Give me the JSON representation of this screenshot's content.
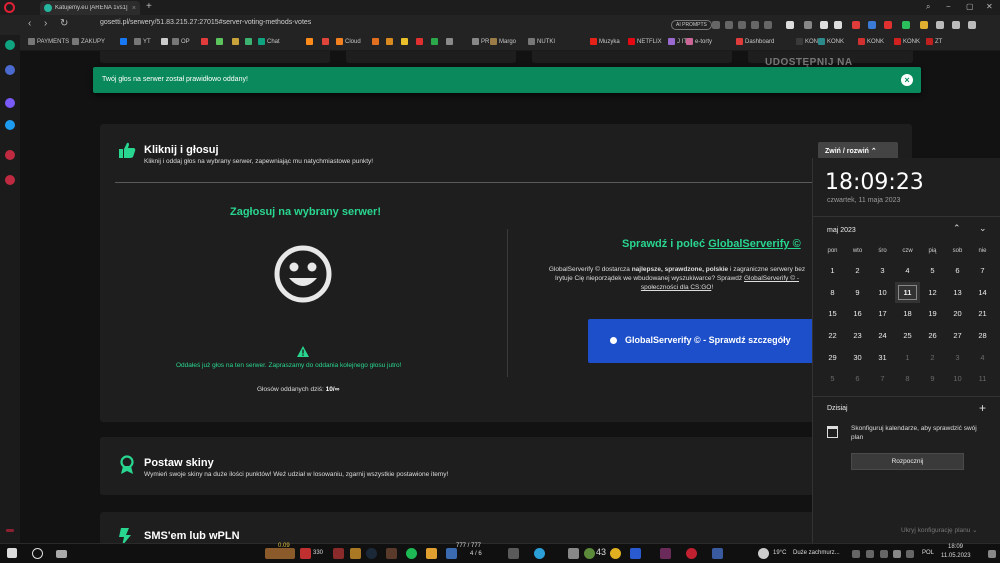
{
  "browser": {
    "tab_title": "Katujemy.eu [ARENA 1vs1]",
    "tab_close": "×",
    "new_tab": "+",
    "url": "gosetti.pl/serwery/51.83.215.27:27015#server-voting-methods-votes",
    "ai_prompts": "AI PROMPTS",
    "nav": {
      "back": "‹",
      "forward": "›",
      "reload": "↻"
    },
    "window": {
      "minimize": "−",
      "maximize": "▢",
      "close": "✕"
    }
  },
  "bookmarks": [
    {
      "label": "PAYMENTS",
      "color": "#777777"
    },
    {
      "label": "ZAKUPY",
      "color": "#777777"
    },
    {
      "label": "",
      "color": "#1877f2"
    },
    {
      "label": "YT",
      "color": "#777777"
    },
    {
      "label": "",
      "color": "#cccccc"
    },
    {
      "label": "OP",
      "color": "#777777"
    },
    {
      "label": "",
      "color": "#e23b3b"
    },
    {
      "label": "",
      "color": "#5cc45c"
    },
    {
      "label": "",
      "color": "#c8a33c"
    },
    {
      "label": "",
      "color": "#3cb371"
    },
    {
      "label": "Chat",
      "color": "#10a37f"
    },
    {
      "label": "",
      "color": "#ff8c1a"
    },
    {
      "label": "",
      "color": "#e0453c"
    },
    {
      "label": "Cloud",
      "color": "#f48120"
    },
    {
      "label": "",
      "color": "#e07020"
    },
    {
      "label": "",
      "color": "#d98b1f"
    },
    {
      "label": "",
      "color": "#e8c02a"
    },
    {
      "label": "",
      "color": "#e03030"
    },
    {
      "label": "",
      "color": "#2aa84a"
    },
    {
      "label": "",
      "color": "#8a8a8a"
    },
    {
      "label": "PR",
      "color": "#888888"
    },
    {
      "label": "Margo",
      "color": "#9b7b46"
    },
    {
      "label": "NUTKI",
      "color": "#777777"
    },
    {
      "label": "Muzyka",
      "color": "#e62117"
    },
    {
      "label": "NETFLIX",
      "color": "#e50914"
    },
    {
      "label": "J IT",
      "color": "#9a6ad0"
    },
    {
      "label": "e-torty",
      "color": "#cc6699"
    },
    {
      "label": "Dashboard",
      "color": "#e03c3c"
    },
    {
      "label": "KONK",
      "color": "#3a3a3a"
    },
    {
      "label": "KONK",
      "color": "#2d8a8a"
    },
    {
      "label": "KONK",
      "color": "#d03030"
    },
    {
      "label": "KONK",
      "color": "#d02020"
    },
    {
      "label": "ZT",
      "color": "#c02020"
    }
  ],
  "page": {
    "share_text": "UDOSTĘPNIJ NA",
    "toast": {
      "message": "Twój głos na serwer został prawidłowo oddany!",
      "close": "×"
    },
    "vote_card": {
      "title": "Kliknij i głosuj",
      "subtitle": "Kliknij i oddaj głos na wybrany serwer, zapewniając mu natychmiastowe punkty!",
      "collapse_label": "Zwiń / rozwiń",
      "vote_title": "Zagłosuj na wybrany serwer!",
      "warning": "Oddałeś już głos na ten serwer. Zapraszamy do oddania kolejnego głosu jutro!",
      "votes_label": "Głosów oddanych dziś:",
      "votes_value": "10/∞",
      "gs_title_prefix": "Sprawdź i poleć",
      "gs_title_link": "GlobalServerify ©",
      "gs_desc_1": "GlobalServerify © dostarcza",
      "gs_desc_bold": "najlepsze, sprawdzone, polskie",
      "gs_desc_2": "i zagraniczne serwery bez",
      "gs_desc_3": "Irytuje Cię nieporządek we wbudowanej wyszukiwarce? Sprawdź",
      "gs_desc_link": "GlobalServerify © -",
      "gs_desc_link2": "społeczności dla CS:GO",
      "gs_desc_end": "!",
      "gs_button": "GlobalServerify © - Sprawdź szczegóły"
    },
    "skins_card": {
      "title": "Postaw skiny",
      "subtitle": "Wymień swoje skiny na duże ilości punktów! Weź udział w losowaniu, zgarnij wszystkie postawione itemy!"
    },
    "sms_card": {
      "title": "SMS'em lub wPLN"
    }
  },
  "calendar": {
    "time": "18:09:23",
    "date": "czwartek, 11 maja 2023",
    "month": "maj 2023",
    "prev": "⌃",
    "next": "⌄",
    "weekdays": [
      "pon",
      "wto",
      "śro",
      "czw",
      "pią",
      "sob",
      "nie"
    ],
    "days": [
      {
        "n": "1",
        "dim": false
      },
      {
        "n": "2",
        "dim": false
      },
      {
        "n": "3",
        "dim": false
      },
      {
        "n": "4",
        "dim": false
      },
      {
        "n": "5",
        "dim": false
      },
      {
        "n": "6",
        "dim": false
      },
      {
        "n": "7",
        "dim": false
      },
      {
        "n": "8",
        "dim": false
      },
      {
        "n": "9",
        "dim": false
      },
      {
        "n": "10",
        "dim": false
      },
      {
        "n": "11",
        "dim": false,
        "today": true
      },
      {
        "n": "12",
        "dim": false
      },
      {
        "n": "13",
        "dim": false
      },
      {
        "n": "14",
        "dim": false
      },
      {
        "n": "15",
        "dim": false
      },
      {
        "n": "16",
        "dim": false
      },
      {
        "n": "17",
        "dim": false
      },
      {
        "n": "18",
        "dim": false
      },
      {
        "n": "19",
        "dim": false
      },
      {
        "n": "20",
        "dim": false
      },
      {
        "n": "21",
        "dim": false
      },
      {
        "n": "22",
        "dim": false
      },
      {
        "n": "23",
        "dim": false
      },
      {
        "n": "24",
        "dim": false
      },
      {
        "n": "25",
        "dim": false
      },
      {
        "n": "26",
        "dim": false
      },
      {
        "n": "27",
        "dim": false
      },
      {
        "n": "28",
        "dim": false
      },
      {
        "n": "29",
        "dim": false
      },
      {
        "n": "30",
        "dim": false
      },
      {
        "n": "31",
        "dim": false
      },
      {
        "n": "1",
        "dim": true
      },
      {
        "n": "2",
        "dim": true
      },
      {
        "n": "3",
        "dim": true
      },
      {
        "n": "4",
        "dim": true
      },
      {
        "n": "5",
        "dim": true
      },
      {
        "n": "6",
        "dim": true
      },
      {
        "n": "7",
        "dim": true
      },
      {
        "n": "8",
        "dim": true
      },
      {
        "n": "9",
        "dim": true
      },
      {
        "n": "10",
        "dim": true
      },
      {
        "n": "11",
        "dim": true
      }
    ],
    "today_label": "Dzisiaj",
    "add": "+",
    "empty_message": "Skonfiguruj kalendarze, aby sprawdzić swój plan",
    "start_button": "Rozpocznij",
    "hide_plan": "Ukryj konfigurację planu ⌄"
  },
  "taskbar": {
    "weather": "Duże zachmurz...",
    "temp": "19°C",
    "lang": "POL",
    "time": "18:09",
    "date": "11.05.2023",
    "counter_1": "330",
    "counter_2": "43",
    "game_stats": "777 / 777",
    "game_stats2": "4 / 6",
    "game_hp": "0.09"
  },
  "colors": {
    "accent_green": "#29d68f",
    "toast_green": "#0a8a5c",
    "button_blue": "#1c4fc9"
  }
}
